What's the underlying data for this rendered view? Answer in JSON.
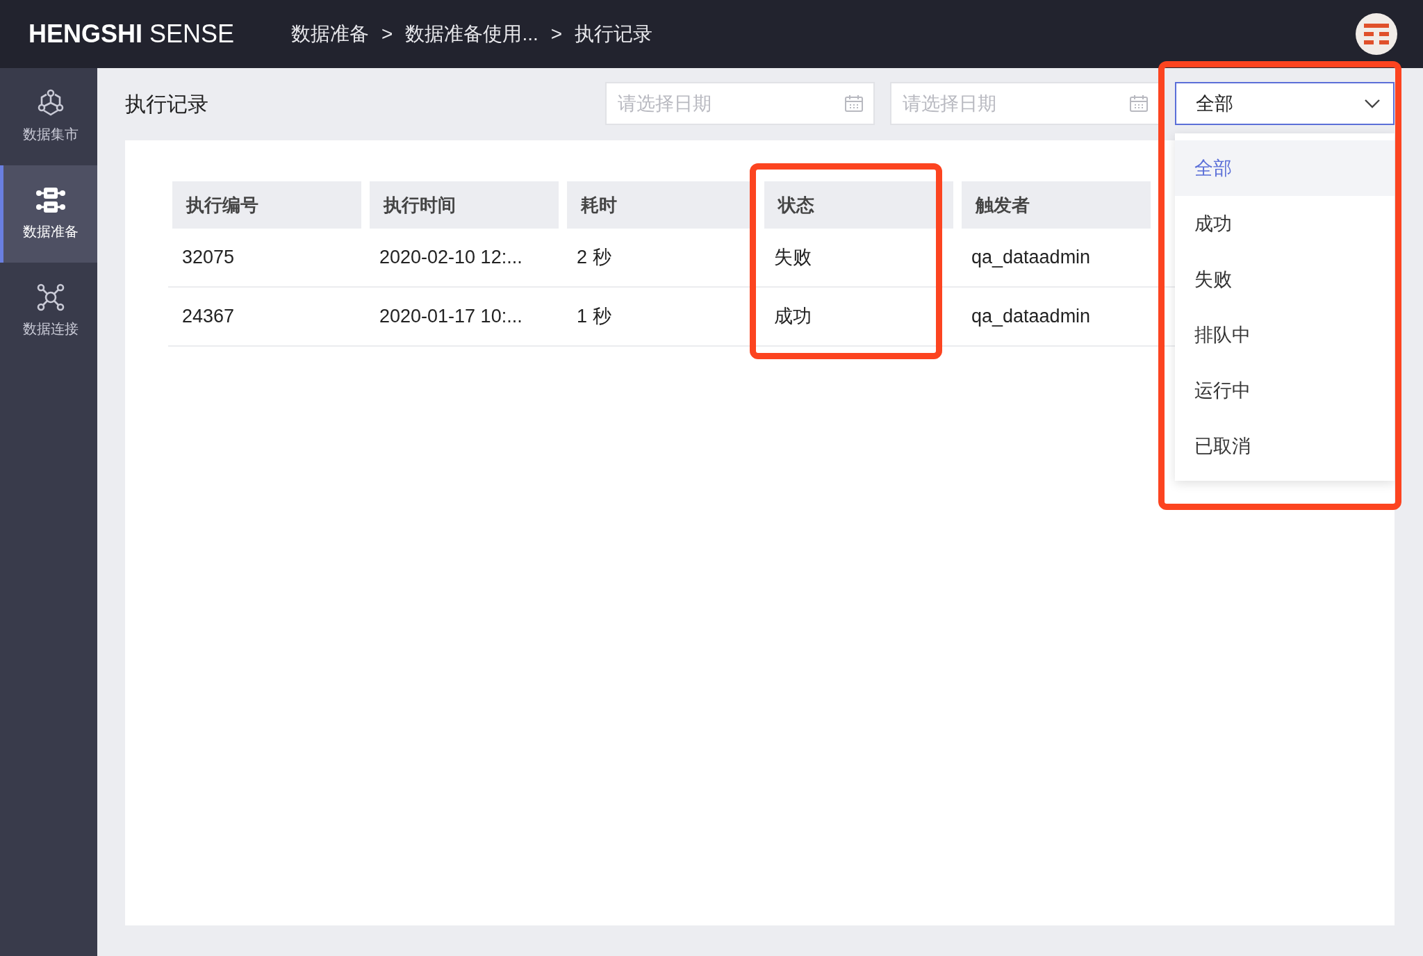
{
  "app": {
    "logo": "**HENGSHI** SENSE"
  },
  "breadcrumb": {
    "items": [
      {
        "label": "数据准备"
      },
      {
        "label": "数据准备使用..."
      },
      {
        "label": "执行记录"
      }
    ],
    "separators": [
      ">",
      ">"
    ]
  },
  "sidebar": {
    "items": [
      {
        "label": "数据集市",
        "kind": "market",
        "selected": false
      },
      {
        "label": "数据准备",
        "kind": "prepare",
        "selected": true
      },
      {
        "label": "数据连接",
        "kind": "connect",
        "selected": false
      }
    ]
  },
  "page": {
    "title": "执行记录"
  },
  "filters": {
    "start_date": {
      "placeholder": "请选择日期"
    },
    "end_date": {
      "placeholder": "请选择日期"
    },
    "status": {
      "value": "全部",
      "expanded": true,
      "highlighted": true,
      "options": [
        {
          "label": "全部",
          "selected": true
        },
        {
          "label": "成功",
          "selected": false
        },
        {
          "label": "失败",
          "selected": false
        },
        {
          "label": "排队中",
          "selected": false
        },
        {
          "label": "运行中",
          "selected": false
        },
        {
          "label": "已取消",
          "selected": false
        }
      ]
    }
  },
  "table": {
    "columns": [
      {
        "label": "执行编号",
        "highlighted": false
      },
      {
        "label": "执行时间",
        "highlighted": false
      },
      {
        "label": "耗时",
        "highlighted": false
      },
      {
        "label": "状态",
        "highlighted": true
      },
      {
        "label": "触发者",
        "highlighted": false
      }
    ],
    "rows": [
      [
        "32075",
        "2020-02-10 12:...",
        "2 秒",
        "失败",
        "qa_dataadmin"
      ],
      [
        "24367",
        "2020-01-17 10:...",
        "1 秒",
        "成功",
        "qa_dataadmin"
      ]
    ]
  }
}
